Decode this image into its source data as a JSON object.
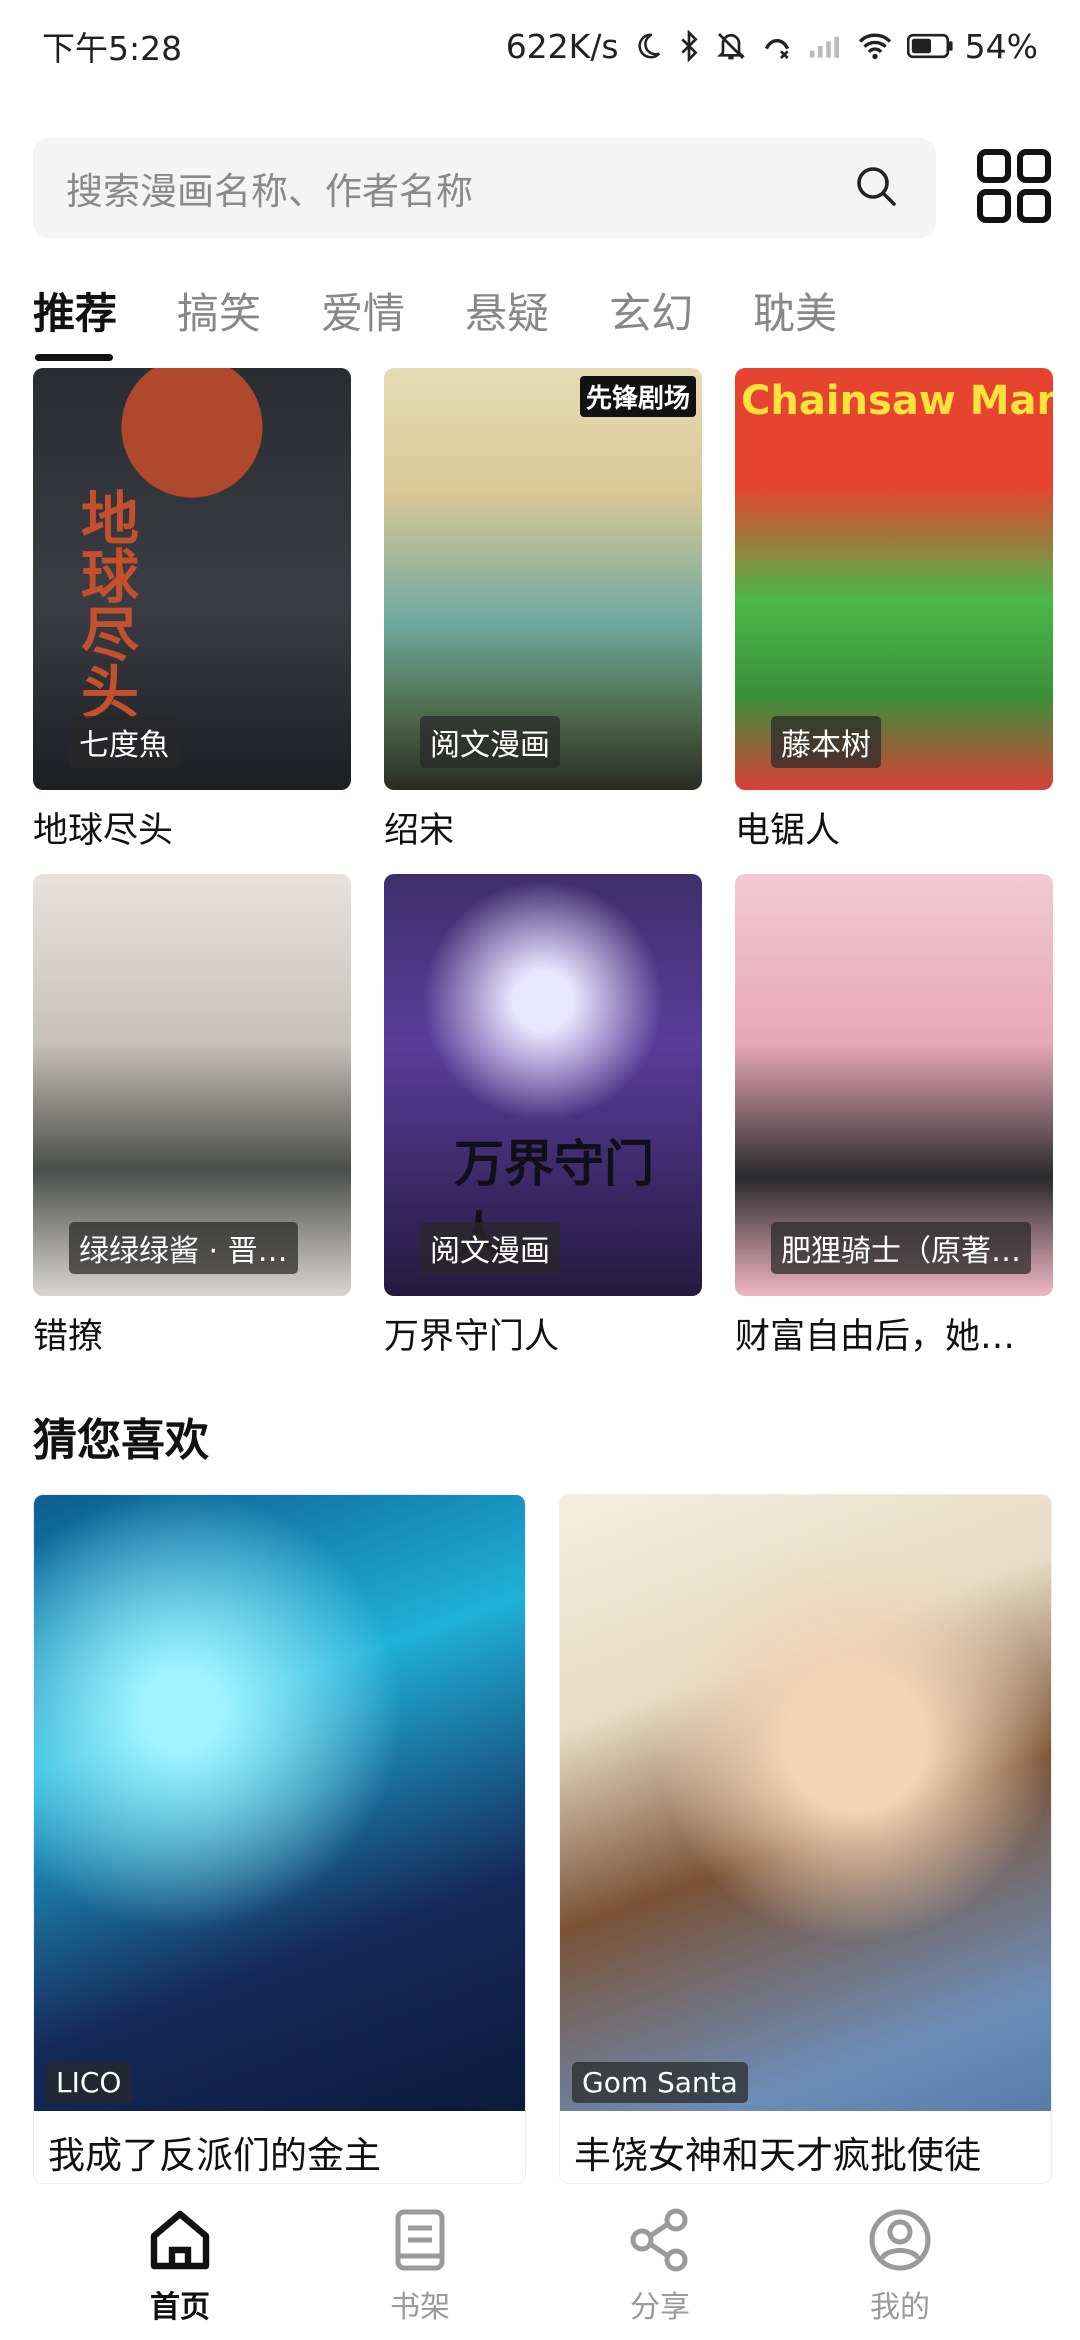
{
  "status_bar": {
    "time": "下午5:28",
    "net_speed": "622K/s",
    "battery": "54%"
  },
  "search": {
    "placeholder": "搜索漫画名称、作者名称"
  },
  "tabs": [
    {
      "label": "推荐",
      "active": true
    },
    {
      "label": "搞笑",
      "active": false
    },
    {
      "label": "爱情",
      "active": false
    },
    {
      "label": "悬疑",
      "active": false
    },
    {
      "label": "玄幻",
      "active": false
    },
    {
      "label": "耽美",
      "active": false
    }
  ],
  "recommend": [
    {
      "title": "地球尽头",
      "author": "七度魚",
      "cover_text": "地球尽头"
    },
    {
      "title": "绍宋",
      "author": "阅文漫画",
      "cover_text": "先锋剧场"
    },
    {
      "title": "电锯人",
      "author": "藤本树",
      "cover_text": "Chainsaw Man"
    },
    {
      "title": "错撩",
      "author": "绿绿绿酱 · 晋…",
      "cover_text": ""
    },
    {
      "title": "万界守门人",
      "author": "阅文漫画",
      "cover_text": "万界守门人"
    },
    {
      "title": "财富自由后，她…",
      "author": "肥狸骑士（原著…",
      "cover_text": ""
    }
  ],
  "section": {
    "title": "猜您喜欢"
  },
  "likes": [
    {
      "title": "我成了反派们的金主",
      "author": "LICO"
    },
    {
      "title": "丰饶女神和天才疯批使徒",
      "author": "Gom Santa"
    }
  ],
  "bottom_nav": [
    {
      "label": "首页",
      "icon": "home-icon",
      "active": true
    },
    {
      "label": "书架",
      "icon": "bookshelf-icon",
      "active": false
    },
    {
      "label": "分享",
      "icon": "share-icon",
      "active": false
    },
    {
      "label": "我的",
      "icon": "profile-icon",
      "active": false
    }
  ]
}
